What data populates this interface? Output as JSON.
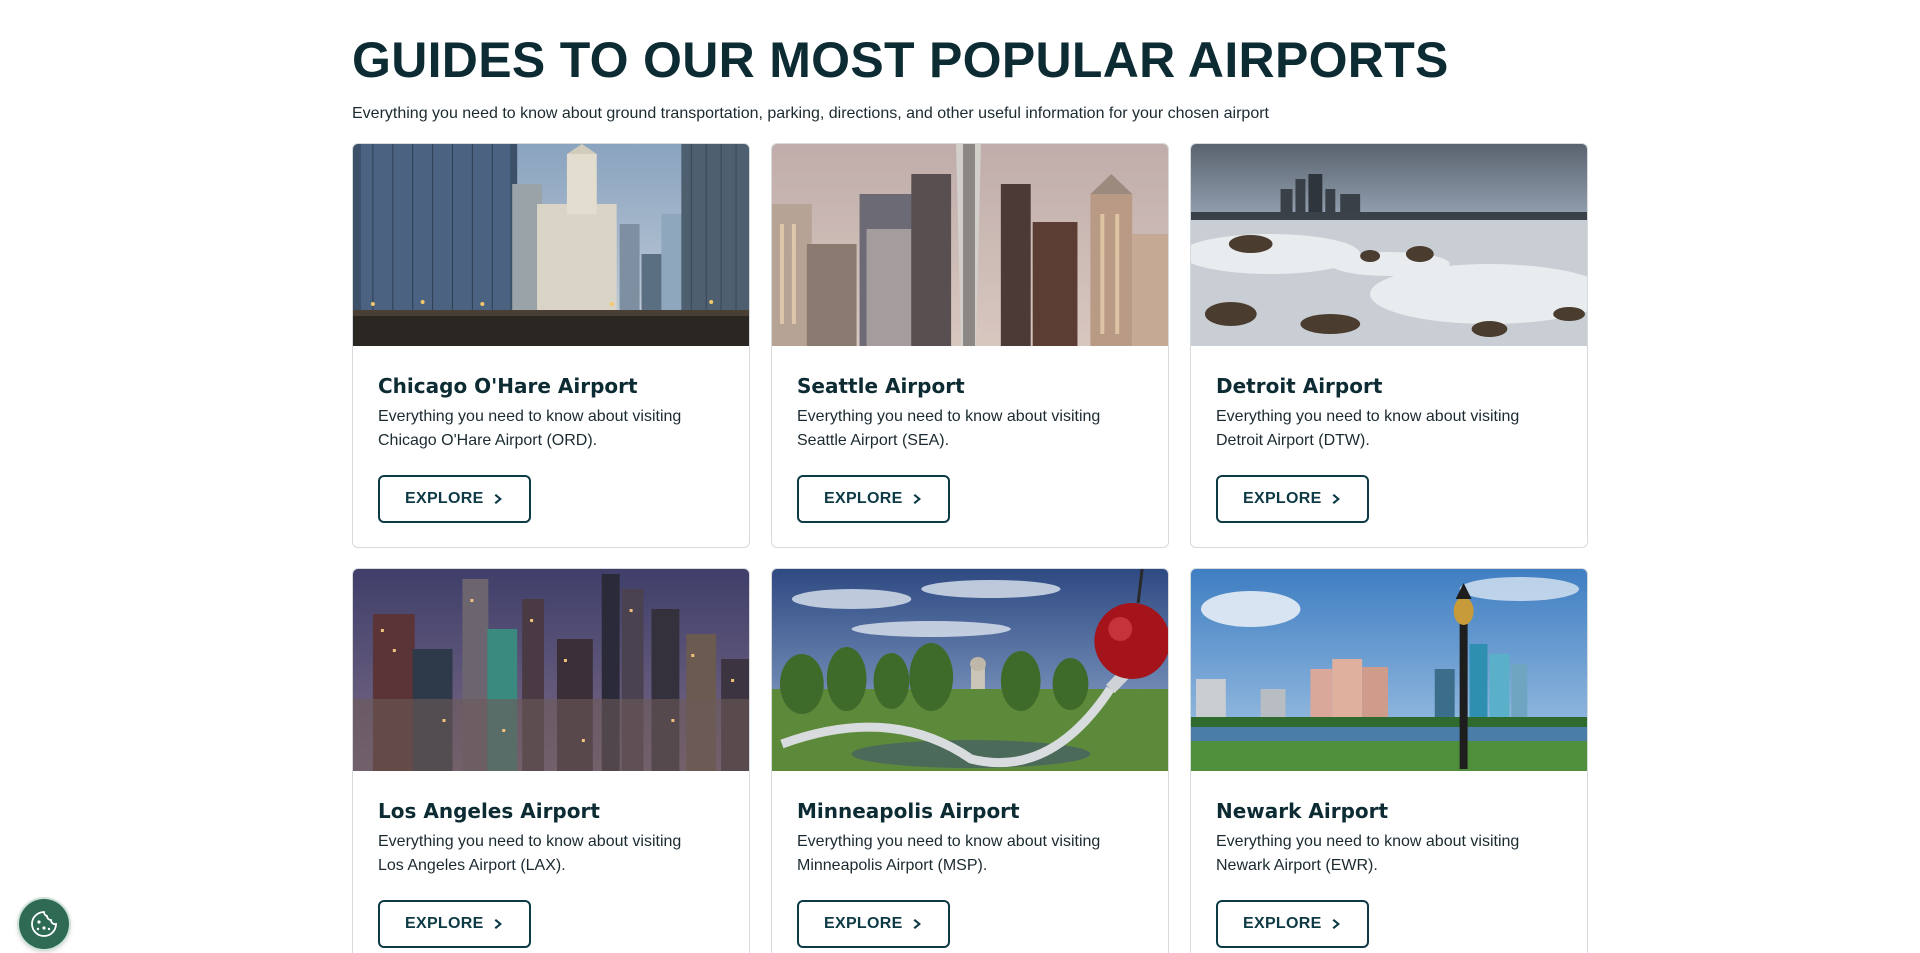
{
  "header": {
    "title": "GUIDES TO OUR MOST POPULAR AIRPORTS",
    "subtitle": "Everything you need to know about ground transportation, parking, directions, and other useful information for your chosen airport"
  },
  "cards": [
    {
      "name": "Chicago O'Hare Airport",
      "description": "Everything you need to know about visiting Chicago O'Hare Airport (ORD).",
      "button_label": "EXPLORE",
      "image": "chicago-skyline-river"
    },
    {
      "name": "Seattle Airport",
      "description": "Everything you need to know about visiting Seattle Airport (SEA).",
      "button_label": "EXPLORE",
      "image": "seattle-space-needle"
    },
    {
      "name": "Detroit Airport",
      "description": "Everything you need to know about visiting Detroit Airport (DTW).",
      "button_label": "EXPLORE",
      "image": "detroit-frozen-shore"
    },
    {
      "name": "Los Angeles Airport",
      "description": "Everything you need to know about visiting Los Angeles Airport (LAX).",
      "button_label": "EXPLORE",
      "image": "los-angeles-dusk"
    },
    {
      "name": "Minneapolis Airport",
      "description": "Everything you need to know about visiting Minneapolis Airport (MSP).",
      "button_label": "EXPLORE",
      "image": "minneapolis-spoonbridge"
    },
    {
      "name": "Newark Airport",
      "description": "Everything you need to know about visiting Newark Airport (EWR).",
      "button_label": "EXPLORE",
      "image": "newark-waterfront"
    }
  ],
  "icons": {
    "explore_button_icon": "chevron-right-icon",
    "cookie_button_icon": "cookie-icon"
  },
  "colors": {
    "heading": "#0d2b33",
    "button_border": "#0d3a45",
    "card_border": "#d6dadc",
    "cookie_button": "#2f6a55"
  }
}
